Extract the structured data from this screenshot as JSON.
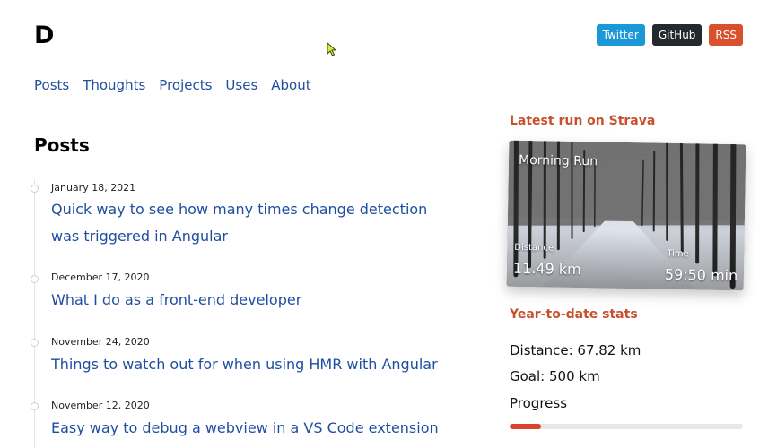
{
  "site": {
    "logo": "D"
  },
  "social": {
    "twitter": "Twitter",
    "github": "GitHub",
    "rss": "RSS"
  },
  "nav": [
    "Posts",
    "Thoughts",
    "Projects",
    "Uses",
    "About"
  ],
  "posts_heading": "Posts",
  "posts": [
    {
      "date": "January 18, 2021",
      "title": "Quick way to see how many times change detection was triggered in Angular"
    },
    {
      "date": "December 17, 2020",
      "title": "What I do as a front-end developer"
    },
    {
      "date": "November 24, 2020",
      "title": "Things to watch out for when using HMR with Angular"
    },
    {
      "date": "November 12, 2020",
      "title": "Easy way to debug a webview in a VS Code extension"
    }
  ],
  "strava": {
    "heading": "Latest run on Strava",
    "run_name": "Morning Run",
    "distance_label": "Distance",
    "distance_value": "11.49 km",
    "time_label": "Time",
    "time_value": "59:50 min"
  },
  "ytd": {
    "heading": "Year-to-date stats",
    "distance": "Distance: 67.82 km",
    "goal": "Goal: 500 km",
    "progress_label": "Progress",
    "progress_fraction": 0.136
  },
  "colors": {
    "accent": "#c8502d",
    "link": "#1f4ea0",
    "progress": "#d9452b"
  },
  "icons": {
    "cursor": "mouse-pointer-icon"
  }
}
